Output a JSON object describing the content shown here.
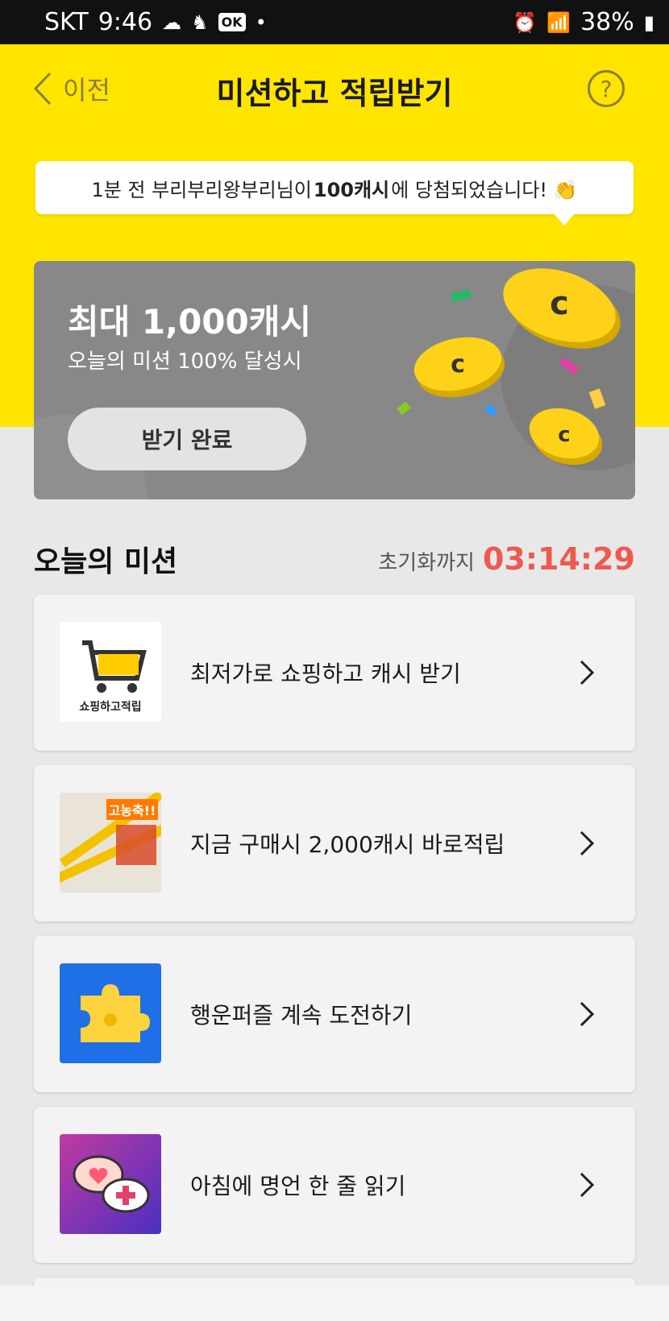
{
  "status_bar": {
    "carrier": "SKT",
    "time": "9:46",
    "ok_badge": "OK",
    "dot": "•",
    "battery": "38%"
  },
  "header": {
    "back_label": "이전",
    "title": "미션하고 적립받기",
    "help": "?"
  },
  "winner_notice": {
    "prefix": "1분 전 부리부리왕부리님이 ",
    "amount": "100캐시",
    "suffix": "에 당첨되었습니다! 👏"
  },
  "promo": {
    "title": "최대 1,000캐시",
    "subtitle": "오늘의 미션 100% 달성시",
    "button": "받기 완료"
  },
  "missions_section": {
    "title": "오늘의 미션",
    "timer_label": "초기화까지",
    "timer_value": "03:14:29"
  },
  "missions": [
    {
      "label": "최저가로 쇼핑하고 캐시 받기",
      "thumb_text": "쇼핑하고적립"
    },
    {
      "label": "지금 구매시 2,000캐시 바로적립",
      "thumb_text": "고농축!!"
    },
    {
      "label": "행운퍼즐 계속 도전하기"
    },
    {
      "label": "아침에 명언 한 줄 읽기"
    }
  ],
  "colors": {
    "accent_yellow": "#ffe500",
    "timer_red": "#ee5a4f",
    "promo_gray": "#888888"
  }
}
